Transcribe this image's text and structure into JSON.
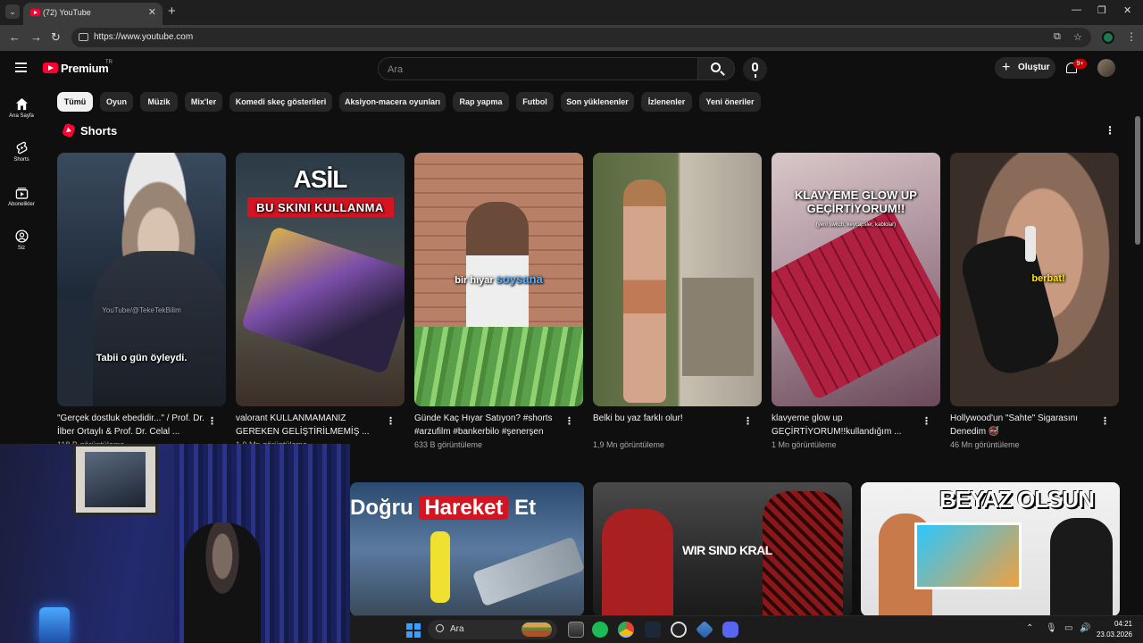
{
  "browser": {
    "tab_title": "(72) YouTube",
    "url": "https://www.youtube.com"
  },
  "header": {
    "logo_text": "Premium",
    "logo_region": "TR",
    "search_placeholder": "Ara",
    "create_label": "Oluştur",
    "notification_count": "9+"
  },
  "sidebar": {
    "items": [
      {
        "label": "Ana Sayfa",
        "icon": "home-icon"
      },
      {
        "label": "Shorts",
        "icon": "shorts-icon"
      },
      {
        "label": "Abonelikler",
        "icon": "subscriptions-icon"
      },
      {
        "label": "Siz",
        "icon": "you-icon"
      }
    ]
  },
  "chips": [
    "Tümü",
    "Oyun",
    "Müzik",
    "Mix'ler",
    "Komedi skeç gösterileri",
    "Aksiyon-macera oyunları",
    "Rap yapma",
    "Futbol",
    "Son yüklenenler",
    "İzlenenler",
    "Yeni öneriler"
  ],
  "shorts": {
    "section_title": "Shorts",
    "items": [
      {
        "title": "\"Gerçek dostluk ebedidir...\" / Prof. Dr. İlber Ortaylı & Prof. Dr. Celal ...",
        "views": "118 B görüntüleme",
        "caption": "Tabii o gün öyleydi.",
        "watermark": "YouTube/@TekeTekBilim"
      },
      {
        "title": "valorant KULLANMAMANIZ GEREKEN GELİŞTİRİLMEMİŞ ...",
        "views": "1,9 Mn görüntüleme",
        "caption_top": "ASİL",
        "caption_banner": "BU SKINI KULLANMA"
      },
      {
        "title": "Günde Kaç Hıyar Satıyon? #shorts #arzufilm #bankerbilo #şenerşen",
        "views": "633 B görüntüleme",
        "caption_a": "bir hıyar",
        "caption_b": "soysana"
      },
      {
        "title": "Belki bu yaz farklı olur!",
        "views": "1,9 Mn görüntüleme"
      },
      {
        "title": "klavyeme glow up GEÇİRTİYORUM!!kullandığım ...",
        "views": "1 Mn görüntüleme",
        "caption": "KLAVYEME GLOW UP GEÇİRTİYORUM!!",
        "subcaption": "(yeni switch, keycapsler, kablolar)"
      },
      {
        "title": "Hollywood'un \"Sahte\" Sigarasını Denedim 🚭",
        "views": "46 Mn görüntüleme",
        "caption": "berbat!"
      }
    ]
  },
  "videos": [
    {
      "caption_a": "Doğru",
      "caption_b": "Hareket",
      "caption_c": "Et"
    },
    {
      "caption": "WIR SIND KRAL"
    },
    {
      "caption": "BEYAZ OLSUN"
    }
  ],
  "taskbar": {
    "search_label": "Ara",
    "time": "04:21",
    "date": "23.03.2026"
  },
  "colors": {
    "background": "#0f0f0f",
    "chip": "#272727",
    "accent": "#ff0033"
  }
}
